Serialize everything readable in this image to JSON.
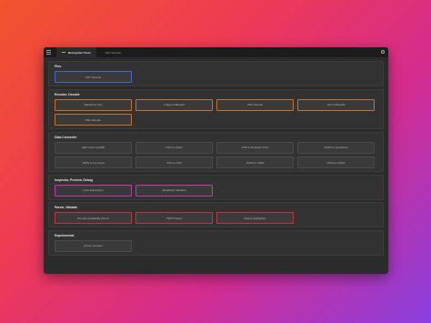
{
  "window": {
    "tabs": [
      {
        "label": "Boring Dev Tools"
      },
      {
        "label": "JWT Decode"
      }
    ]
  },
  "sections": [
    {
      "title": "Pins",
      "buttons": [
        {
          "label": "JWT Decode"
        }
      ]
    },
    {
      "title": "Encoder, Decode",
      "buttons": [
        {
          "label": "Base64 to Text"
        },
        {
          "label": "Image to Base64"
        },
        {
          "label": "JWT Decode"
        },
        {
          "label": "Text to Base64"
        },
        {
          "label": "URL Decode"
        }
      ]
    },
    {
      "title": "Data Converter",
      "buttons": [
        {
          "label": "HEX Color to RGB"
        },
        {
          "label": "CSV to JSON"
        },
        {
          "label": "CSV to Rockstar Trino"
        },
        {
          "label": "JSON to JavaScript"
        },
        {
          "label": "JSON to Go struct"
        },
        {
          "label": "XML to CSV"
        },
        {
          "label": "JSON to YAML"
        },
        {
          "label": "YAML to JSON"
        }
      ]
    },
    {
      "title": "Inspector, Preview, Debug",
      "buttons": [
        {
          "label": "Cron Expression"
        },
        {
          "label": "JavaScript Sandbox"
        }
      ]
    },
    {
      "title": "Parser, Validate",
      "buttons": [
        {
          "label": "Domain Availability Check"
        },
        {
          "label": "JSON Parser"
        },
        {
          "label": "Regex Highlighter"
        }
      ]
    },
    {
      "title": "Experimental",
      "buttons": [
        {
          "label": "screen recorder"
        }
      ]
    }
  ]
}
